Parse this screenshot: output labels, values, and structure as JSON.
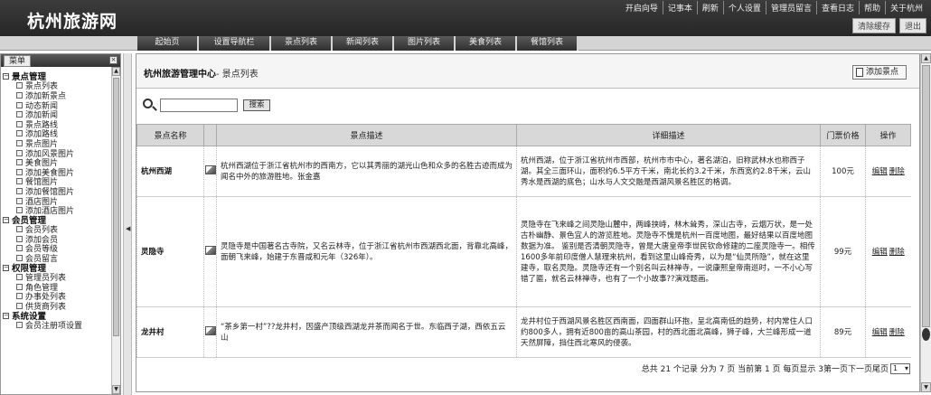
{
  "header": {
    "site_title": "杭州旅游网",
    "nav": [
      "开启向导",
      "记事本",
      "刷新",
      "个人设置",
      "管理员留言",
      "查看日志",
      "帮助",
      "关于杭州"
    ],
    "clear_cache": "清除缓存",
    "logout": "退出"
  },
  "tabs": [
    "起始页",
    "设置导航栏",
    "景点列表",
    "新闻列表",
    "图片列表",
    "美食列表",
    "餐馆列表"
  ],
  "sidebar": {
    "tab_label": "菜单",
    "groups": [
      {
        "label": "景点管理",
        "items": [
          "景点列表",
          "添加新景点",
          "动态新闻",
          "添加新闻",
          "景点路线",
          "添加路线",
          "景点图片",
          "添加风景图片",
          "美食图片",
          "添加美食图片",
          "餐馆图片",
          "添加餐馆图片",
          "酒店图片",
          "添加酒店图片"
        ]
      },
      {
        "label": "会员管理",
        "items": [
          "会员列表",
          "添加会员",
          "会员等级",
          "会员留言"
        ]
      },
      {
        "label": "权限管理",
        "items": [
          "管理员列表",
          "角色管理",
          "办事处列表",
          "供货商列表"
        ]
      },
      {
        "label": "系统设置",
        "items": [
          "会员注册项设置"
        ]
      }
    ]
  },
  "main": {
    "title_main": "杭州旅游管理中心",
    "title_sub": "- 景点列表",
    "add_button": "添加景点",
    "search_button": "搜索",
    "search_value": "",
    "columns": [
      "景点名称",
      "",
      "景点描述",
      "详细描述",
      "门票价格",
      "操作"
    ],
    "rows": [
      {
        "name": "杭州西湖",
        "desc": "杭州西湖位于浙江省杭州市的西南方，它以其秀丽的湖光山色和众多的名胜古迹而成为闻名中外的旅游胜地。张金嘉",
        "detail": "杭州西湖，位于浙江省杭州市西部，杭州市市中心，著名湖泊，旧称武林水也称西子湖。其全三面环山，面积约6.5平方千米，南北长约3.2千米，东西宽约2.8千米，云山秀水是西湖的底色；山水与人文交融是西湖风景名胜区的格调。",
        "price": "100元",
        "edit": "编辑",
        "delete": "删除"
      },
      {
        "name": "灵隐寺",
        "desc": "灵隐寺是中国著名古寺院，又名云林寺，位于浙江省杭州市西湖西北面，背靠北高峰，面朝飞来峰，始建于东晋咸和元年（326年）。",
        "detail": "灵隐寺在飞来峰之间灵隐山麓中，两峰挟峙，林木耸秀，深山古寺，云烟万状，是一处古朴幽静、景色宜人的游览胜地。灵隐寺不愧是杭州一百度地图，最好结果以百度地图数据为准。 鉴别是否清朝灵隐寺，曾是大唐皇帝李世民钦命修建的二座灵隐寺一。相传1600多年前印度僧人慧理来杭州，看到这里山峰奇秀，以为是“仙灵所隐”，就在这里建寺，取名灵隐。灵隐寺还有一个别名叫云林禅寺，一说康熙皇帝南巡时，一不小心写错了匾，就名云林禅寺，也有了一个小故事??演戏题画。",
        "price": "99元",
        "edit": "编辑",
        "delete": "删除"
      },
      {
        "name": "龙井村",
        "desc": "“茶乡第一村”??龙井村，因盛产顶级西湖龙井茶而闻名于世。东临西子湖，西依五云山",
        "detail": "龙井村位于西湖风景名胜区西南面，四面群山环抱，呈北高南低的趋势，村内常住人口约800多人，拥有近800亩的高山茶园，村的西北面北高峰，狮子峰，大兰峰形成一道天然屏障，挡住西北寒风的侵袭。",
        "price": "89元",
        "edit": "编辑",
        "delete": "删除"
      }
    ],
    "pager_text": "总共 21 个记录 分为 7 页 当前第 1 页 每页显示 3第一页下一页尾页",
    "pager_select": "1"
  }
}
